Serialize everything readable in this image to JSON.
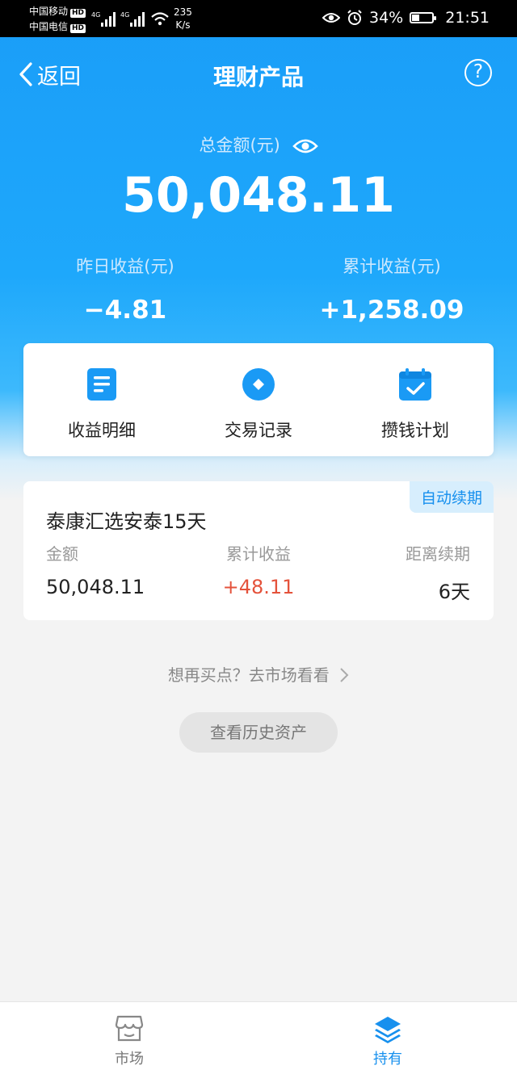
{
  "status_bar": {
    "carrier1": "中国移动",
    "carrier2": "中国电信",
    "hd_badge": "HD",
    "net_type": "4G",
    "speed_value": "235",
    "speed_unit": "K/s",
    "battery": "34%",
    "battery_level": 0.34,
    "time": "21:51"
  },
  "nav": {
    "back_label": "返回",
    "title": "理财产品",
    "help_symbol": "?"
  },
  "summary": {
    "total_label": "总金额(元)",
    "total_value": "50,048.11",
    "yesterday_label": "昨日收益(元)",
    "yesterday_value": "−4.81",
    "cumulative_label": "累计收益(元)",
    "cumulative_value": "+1,258.09"
  },
  "actions": [
    {
      "label": "收益明细",
      "icon": "document-icon"
    },
    {
      "label": "交易记录",
      "icon": "record-icon"
    },
    {
      "label": "攒钱计划",
      "icon": "calendar-check-icon"
    }
  ],
  "product": {
    "badge": "自动续期",
    "name": "泰康汇选安泰15天",
    "amount_label": "金额",
    "amount_value": "50,048.11",
    "earnings_label": "累计收益",
    "earnings_value": "+48.11",
    "renew_label": "距离续期",
    "renew_value": "6天"
  },
  "market_link": "想再买点？去市场看看",
  "history_button": "查看历史资产",
  "tabs": [
    {
      "label": "市场",
      "icon": "store-icon",
      "active": false
    },
    {
      "label": "持有",
      "icon": "layers-icon",
      "active": true
    }
  ],
  "colors": {
    "primary": "#1a9df8",
    "accent": "#1790ee",
    "negative_red": "#e4523b",
    "background": "#f3f3f3"
  }
}
